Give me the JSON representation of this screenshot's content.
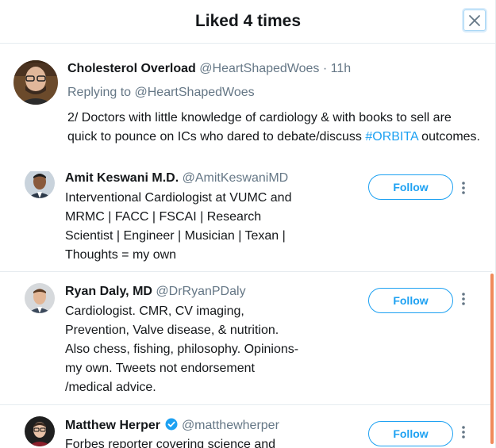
{
  "header": {
    "title": "Liked 4 times",
    "close_icon": "close-icon"
  },
  "tweet": {
    "name": "Cholesterol Overload",
    "handle": "@HeartShapedWoes",
    "separator": "·",
    "time": "11h",
    "reply_prefix": "Replying to",
    "reply_to": "@HeartShapedWoes",
    "body_part1": "2/ Doctors with little knowledge of cardiology & with books to sell are quick to pounce on ICs who dared to debate/discuss ",
    "hashtag": "#ORBITA",
    "body_part2": " outcomes."
  },
  "users": [
    {
      "name": "Amit Keswani M.D.",
      "handle": "@AmitKeswaniMD",
      "bio_lines": [
        "Interventional Cardiologist at VUMC and",
        "MRMC | FACC | FSCAI | Research",
        "Scientist | Engineer | Musician | Texan |",
        "Thoughts = my own"
      ],
      "follow_label": "Follow"
    },
    {
      "name": "Ryan Daly, MD",
      "handle": "@DrRyanPDaly",
      "bio_lines": [
        "Cardiologist. CMR, CV imaging,",
        "Prevention, Valve disease, & nutrition.",
        "Also chess, fishing, philosophy. Opinions-",
        "my own. Tweets not endorsement",
        "/medical advice."
      ],
      "follow_label": "Follow"
    },
    {
      "name": "Matthew Herper",
      "handle": "@matthewherper",
      "verified": true,
      "bio_lines": [
        "Forbes reporter covering science and"
      ],
      "follow_label": "Follow"
    }
  ],
  "colors": {
    "accent": "#1da1f2",
    "secondary_text": "#657786",
    "scrollbar": "#f08a5a"
  }
}
